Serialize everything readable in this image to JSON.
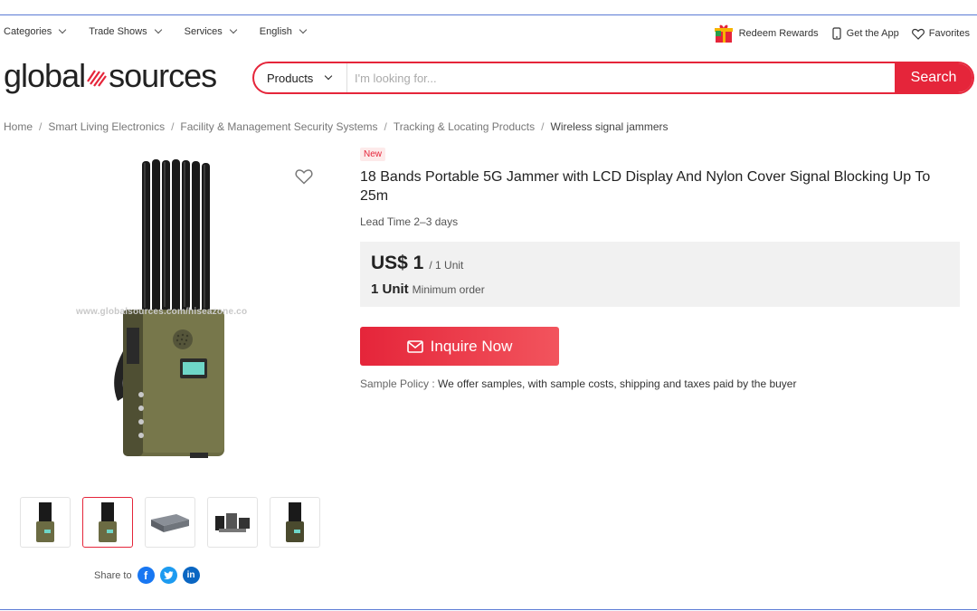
{
  "colors": {
    "brand_red": "#e5253a",
    "border_blue": "#5b7bd5",
    "price_bg": "#f1f1f1"
  },
  "topnav": {
    "left": [
      {
        "label": "Categories",
        "icon": "chevron-down-icon"
      },
      {
        "label": "Trade Shows",
        "icon": "chevron-down-icon"
      },
      {
        "label": "Services",
        "icon": "chevron-down-icon"
      },
      {
        "label": "English",
        "icon": "chevron-down-icon"
      }
    ],
    "right": [
      {
        "label": "Redeem Rewards",
        "icon": "gift-icon"
      },
      {
        "label": "Get the App",
        "icon": "phone-icon"
      },
      {
        "label": "Favorites",
        "icon": "heart-icon"
      }
    ]
  },
  "logo": {
    "left": "global",
    "right": "sources"
  },
  "search": {
    "category": "Products",
    "placeholder": "I'm looking for...",
    "button": "Search"
  },
  "breadcrumb": [
    "Home",
    "Smart Living Electronics",
    "Facility & Management Security Systems",
    "Tracking & Locating Products",
    "Wireless signal jammers"
  ],
  "gallery": {
    "watermark": "www.globalsources.com/hiseazone.co",
    "thumbnails": [
      "jammer-front",
      "jammer-front-selected",
      "jammer-box",
      "jammer-accessories",
      "jammer-front"
    ],
    "selected_index": 1,
    "share_label": "Share to",
    "share_icons": [
      "facebook-icon",
      "twitter-icon",
      "linkedin-icon"
    ]
  },
  "product": {
    "badge": "New",
    "title": "18 Bands Portable 5G Jammer with LCD Display And Nylon Cover Signal Blocking Up To 25m",
    "lead_time": "Lead Time 2–3 days",
    "price": "US$ 1",
    "price_unit": "/ 1 Unit",
    "moq_qty": "1 Unit",
    "moq_label": "Minimum order",
    "inquire": "Inquire Now",
    "sample_key": "Sample Policy :",
    "sample_value": "We offer samples, with sample costs, shipping and taxes paid by the buyer"
  }
}
